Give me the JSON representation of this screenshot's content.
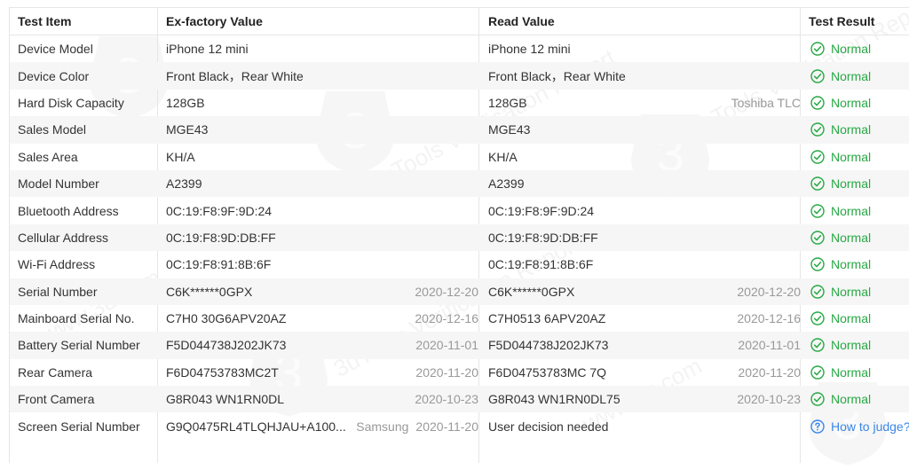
{
  "header": {
    "test_item": "Test Item",
    "ex_factory": "Ex-factory Value",
    "read_value": "Read Value",
    "test_result": "Test Result"
  },
  "rows": [
    {
      "item": "Device Model",
      "ex": "iPhone 12 mini",
      "ex_date": "",
      "ex_brand": "",
      "read": "iPhone 12 mini",
      "read_date": "",
      "read_brand": "",
      "result": "Normal",
      "status": "ok"
    },
    {
      "item": "Device Color",
      "ex": "Front Black，Rear White",
      "ex_date": "",
      "ex_brand": "",
      "read": "Front Black，Rear White",
      "read_date": "",
      "read_brand": "",
      "result": "Normal",
      "status": "ok"
    },
    {
      "item": "Hard Disk Capacity",
      "ex": "128GB",
      "ex_date": "",
      "ex_brand": "",
      "read": "128GB",
      "read_date": "",
      "read_brand": "Toshiba TLC",
      "result": "Normal",
      "status": "ok"
    },
    {
      "item": "Sales Model",
      "ex": "MGE43",
      "ex_date": "",
      "ex_brand": "",
      "read": "MGE43",
      "read_date": "",
      "read_brand": "",
      "result": "Normal",
      "status": "ok"
    },
    {
      "item": "Sales Area",
      "ex": "KH/A",
      "ex_date": "",
      "ex_brand": "",
      "read": "KH/A",
      "read_date": "",
      "read_brand": "",
      "result": "Normal",
      "status": "ok"
    },
    {
      "item": "Model Number",
      "ex": "A2399",
      "ex_date": "",
      "ex_brand": "",
      "read": "A2399",
      "read_date": "",
      "read_brand": "",
      "result": "Normal",
      "status": "ok"
    },
    {
      "item": "Bluetooth Address",
      "ex": "0C:19:F8:9F:9D:24",
      "ex_date": "",
      "ex_brand": "",
      "read": "0C:19:F8:9F:9D:24",
      "read_date": "",
      "read_brand": "",
      "result": "Normal",
      "status": "ok"
    },
    {
      "item": "Cellular Address",
      "ex": "0C:19:F8:9D:DB:FF",
      "ex_date": "",
      "ex_brand": "",
      "read": "0C:19:F8:9D:DB:FF",
      "read_date": "",
      "read_brand": "",
      "result": "Normal",
      "status": "ok"
    },
    {
      "item": "Wi-Fi Address",
      "ex": "0C:19:F8:91:8B:6F",
      "ex_date": "",
      "ex_brand": "",
      "read": "0C:19:F8:91:8B:6F",
      "read_date": "",
      "read_brand": "",
      "result": "Normal",
      "status": "ok"
    },
    {
      "item": "Serial Number",
      "ex": "C6K******0GPX",
      "ex_date": "2020-12-20",
      "ex_brand": "",
      "read": "C6K******0GPX",
      "read_date": "2020-12-20",
      "read_brand": "",
      "result": "Normal",
      "status": "ok"
    },
    {
      "item": "Mainboard Serial No.",
      "ex": "C7H0    30G6APV20AZ",
      "ex_date": "2020-12-16",
      "ex_brand": "",
      "read": "C7H0513    6APV20AZ",
      "read_date": "2020-12-16",
      "read_brand": "",
      "result": "Normal",
      "status": "ok"
    },
    {
      "item": "Battery Serial Number",
      "ex": "F5D044738J202JK73",
      "ex_date": "2020-11-01",
      "ex_brand": "",
      "read": "F5D044738J202JK73",
      "read_date": "2020-11-01",
      "read_brand": "",
      "result": "Normal",
      "status": "ok"
    },
    {
      "item": "Rear Camera",
      "ex": "F6D04753783MC2T",
      "ex_date": "2020-11-20",
      "ex_brand": "",
      "read": "F6D04753783MC    7Q",
      "read_date": "2020-11-20",
      "read_brand": "",
      "result": "Normal",
      "status": "ok"
    },
    {
      "item": "Front Camera",
      "ex": "G8R043    WN1RN0DL",
      "ex_date": "2020-10-23",
      "ex_brand": "",
      "read": "G8R043    WN1RN0DL75",
      "read_date": "2020-10-23",
      "read_brand": "",
      "result": "Normal",
      "status": "ok"
    },
    {
      "item": "Screen Serial Number",
      "ex": "G9Q0475RL4TLQHJAU+A100...",
      "ex_date": "2020-11-20",
      "ex_brand": "Samsung",
      "read": "User decision needed",
      "read_date": "",
      "read_brand": "",
      "result": "How to judge?",
      "status": "help"
    }
  ],
  "watermark": {
    "texts": [
      "3uTools Verification Report",
      "www.3u.com"
    ],
    "logo_glyph": "3"
  },
  "colors": {
    "ok": "#27a844",
    "help": "#3a86e8",
    "alt_row": "#f6f6f6",
    "border": "#e6e6e6",
    "muted": "#999999"
  },
  "icons": {
    "ok": "check-circle-icon",
    "help": "question-circle-icon"
  }
}
